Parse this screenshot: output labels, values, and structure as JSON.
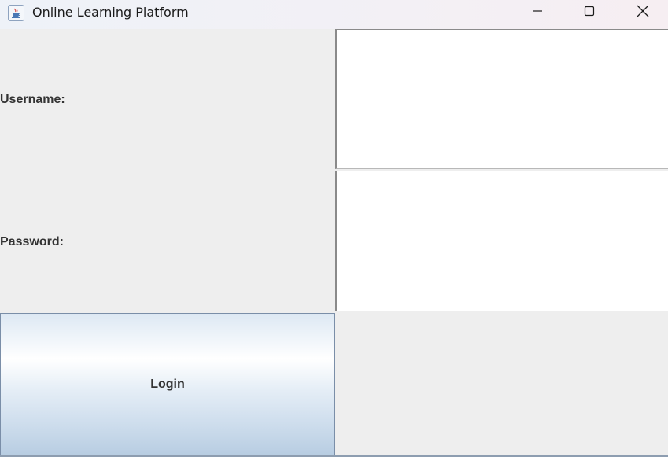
{
  "window": {
    "title": "Online Learning Platform",
    "app_icon": "java-cup-icon",
    "controls": {
      "minimize_icon": "minimize-icon",
      "maximize_icon": "maximize-icon",
      "close_icon": "close-icon"
    }
  },
  "form": {
    "username_label": "Username:",
    "username_value": "",
    "password_label": "Password:",
    "password_value": "",
    "login_label": "Login"
  }
}
